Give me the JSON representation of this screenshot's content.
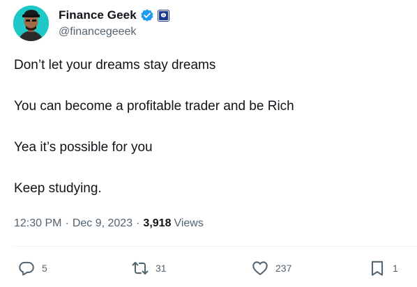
{
  "author": {
    "display_name": "Finance Geek",
    "handle": "@financegeeek",
    "verified_color": "#1d9bf0",
    "affiliate_badge_color": "#1a3a8f"
  },
  "tweet": {
    "lines": [
      "Don’t let your dreams stay dreams",
      "You can become a profitable trader and be Rich",
      "Yea it’s possible for you",
      "Keep studying."
    ]
  },
  "meta": {
    "time": "12:30 PM",
    "separator": "·",
    "date": "Dec 9, 2023",
    "views_count": "3,918",
    "views_label": "Views"
  },
  "actions": {
    "replies": "5",
    "reposts": "31",
    "likes": "237",
    "bookmarks": "1"
  },
  "icons": {
    "reply": "reply-bubble-icon",
    "repost": "repost-icon",
    "like": "heart-icon",
    "bookmark": "bookmark-icon",
    "verified": "verified-badge-icon",
    "affiliate": "affiliate-badge-icon"
  }
}
